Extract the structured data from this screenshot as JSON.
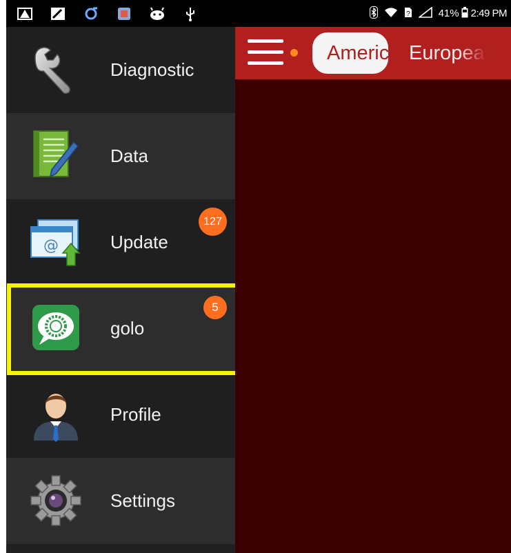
{
  "status_bar": {
    "left_icons": [
      "warning-icon",
      "satellite-icon",
      "sync-icon",
      "app-icon",
      "android-icon",
      "usb-icon"
    ],
    "battery": "41%",
    "time": "2:49 PM"
  },
  "sidebar": {
    "items": [
      {
        "label": "Diagnostic",
        "icon": "wrench-icon",
        "badge": ""
      },
      {
        "label": "Data",
        "icon": "notepad-pencil-icon",
        "badge": ""
      },
      {
        "label": "Update",
        "icon": "update-mail-icon",
        "badge": "127"
      },
      {
        "label": "golo",
        "icon": "golo-chat-icon",
        "badge": "5"
      },
      {
        "label": "Profile",
        "icon": "user-profile-icon",
        "badge": ""
      },
      {
        "label": "Settings",
        "icon": "gear-icon",
        "badge": ""
      }
    ]
  },
  "main": {
    "tabs": [
      {
        "label": "America",
        "active": true
      },
      {
        "label": "European",
        "active": false
      }
    ]
  },
  "colors": {
    "header_red": "#b11f1f",
    "content_bg": "#3c0000",
    "badge_orange": "#ff6d1f",
    "highlight_yellow": "#f7f20a"
  }
}
